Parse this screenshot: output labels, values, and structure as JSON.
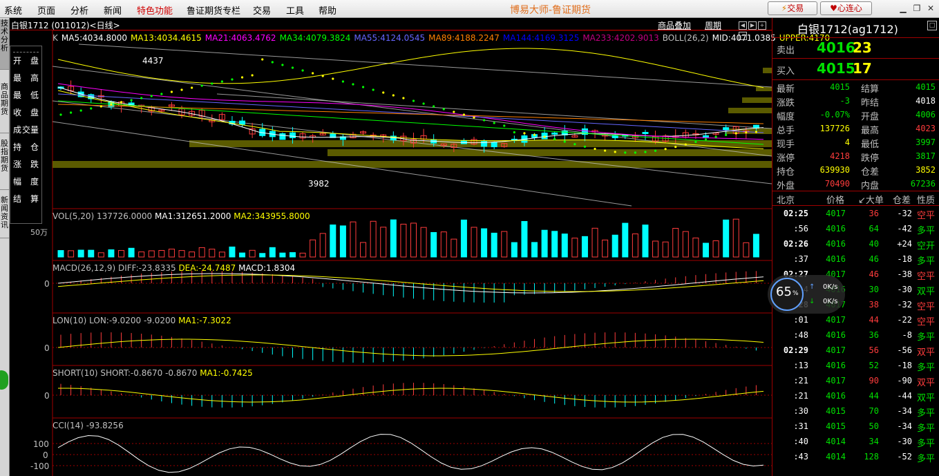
{
  "menu": [
    "系统",
    "页面",
    "分析",
    "新闻",
    "特色功能",
    "鲁证期货专栏",
    "交易",
    "工具",
    "帮助"
  ],
  "app_title": "博易大师-鲁证期货",
  "buttons": {
    "trade": "交易",
    "connect": "心连心"
  },
  "left_tabs": [
    "技术分析",
    "商品期货",
    "股指期货",
    "新闻资讯"
  ],
  "chart": {
    "title": "白银1712 (011012)<日线>",
    "links": [
      "商品叠加",
      "周期"
    ],
    "ma_line": [
      {
        "text": "K",
        "color": "#c0c0c0"
      },
      {
        "text": "MA5:4034.8000",
        "color": "#ffffff"
      },
      {
        "text": "MA13:4034.4615",
        "color": "#ffff00"
      },
      {
        "text": "MA21:4063.4762",
        "color": "#ff00ff"
      },
      {
        "text": "MA34:4079.3824",
        "color": "#00ff00"
      },
      {
        "text": "MA55:4124.0545",
        "color": "#6666ff"
      },
      {
        "text": "MA89:4188.2247",
        "color": "#ff8000"
      },
      {
        "text": "MA144:4169.3125",
        "color": "#0000ff"
      },
      {
        "text": "MA233:4202.9013",
        "color": "#c00080"
      },
      {
        "text": "BOLL(26,2)",
        "color": "#c0c0c0"
      },
      {
        "text": "MID:4071.0385",
        "color": "#ffffff"
      },
      {
        "text": "UPPER:4170",
        "color": "#ffff00"
      }
    ],
    "price_high_label": "4437",
    "price_low_label": "3982",
    "info_box": [
      {
        "l": "开",
        "r": "盘"
      },
      {
        "l": "最",
        "r": "高"
      },
      {
        "l": "最",
        "r": "低"
      },
      {
        "l": "收",
        "r": "盘"
      },
      {
        "l": "成",
        "r": "交量"
      },
      {
        "l": "持",
        "r": "仓"
      },
      {
        "l": "涨",
        "r": "跌"
      },
      {
        "l": "幅",
        "r": "度"
      },
      {
        "l": "结",
        "r": "算"
      }
    ],
    "vol": {
      "label": "VOL(5,20) 137726.0000",
      "ma1": "MA1:312651.2000",
      "ma2": "MA2:343955.8000",
      "axis": "50万"
    },
    "macd": {
      "label": "MACD(26,12,9) DIFF:-23.8335",
      "dea": "DEA:-24.7487",
      "macd": "MACD:1.8304",
      "zero": "0"
    },
    "lon": {
      "label": "LON(10) LON:-9.0200 -9.0200",
      "ma1": "MA1:-7.3022",
      "zero": "0"
    },
    "short": {
      "label": "SHORT(10) SHORT:-0.8670 -0.8670",
      "ma1": "MA1:-0.7425",
      "zero": "0"
    },
    "cci": {
      "label": "CCI(14) -93.8256",
      "ticks": [
        "100",
        "0",
        "-100"
      ]
    }
  },
  "quote": {
    "name": "白银1712(ag1712)",
    "sell": {
      "label": "卖出",
      "price": "4016",
      "vol": "23"
    },
    "buy": {
      "label": "买入",
      "price": "4015",
      "vol": "17"
    },
    "fields": [
      [
        {
          "l": "最新",
          "v": "4015",
          "c": "green"
        },
        {
          "l": "结算",
          "v": "4015",
          "c": "green"
        }
      ],
      [
        {
          "l": "涨跌",
          "v": "-3",
          "c": "green"
        },
        {
          "l": "昨结",
          "v": "4018",
          "c": "white"
        }
      ],
      [
        {
          "l": "幅度",
          "v": "-0.07%",
          "c": "green"
        },
        {
          "l": "开盘",
          "v": "4006",
          "c": "green"
        }
      ],
      [
        {
          "l": "总手",
          "v": "137726",
          "c": "yellow"
        },
        {
          "l": "最高",
          "v": "4023",
          "c": "red"
        }
      ],
      [
        {
          "l": "现手",
          "v": "4",
          "c": "yellow"
        },
        {
          "l": "最低",
          "v": "3997",
          "c": "green"
        }
      ],
      [
        {
          "l": "涨停",
          "v": "4218",
          "c": "red"
        },
        {
          "l": "跌停",
          "v": "3817",
          "c": "green"
        }
      ],
      [
        {
          "l": "持仓",
          "v": "639930",
          "c": "yellow"
        },
        {
          "l": "仓差",
          "v": "3852",
          "c": "yellow"
        }
      ],
      [
        {
          "l": "外盘",
          "v": "70490",
          "c": "red"
        },
        {
          "l": "内盘",
          "v": "67236",
          "c": "green"
        }
      ]
    ],
    "tick_header": [
      "北京",
      "价格",
      "↙大单",
      "仓差",
      "性质"
    ],
    "ticks": [
      {
        "t": "02:25",
        "p": "4017",
        "pc": "green",
        "v": "36",
        "vc": "red",
        "d": "-32",
        "n": "空平",
        "nc": "red",
        "bold": true
      },
      {
        "t": ":56",
        "p": "4016",
        "pc": "green",
        "v": "64",
        "vc": "green",
        "d": "-42",
        "n": "多平",
        "nc": "green",
        "bold": false
      },
      {
        "t": "02:26",
        "p": "4016",
        "pc": "green",
        "v": "40",
        "vc": "green",
        "d": "+24",
        "n": "空开",
        "nc": "green",
        "bold": true
      },
      {
        "t": ":37",
        "p": "4016",
        "pc": "green",
        "v": "46",
        "vc": "green",
        "d": "-18",
        "n": "多平",
        "nc": "green",
        "bold": false
      },
      {
        "t": "02:27",
        "p": "4017",
        "pc": "green",
        "v": "46",
        "vc": "red",
        "d": "-38",
        "n": "空平",
        "nc": "red",
        "bold": true
      },
      {
        "t": ":14",
        "p": "4016",
        "pc": "green",
        "v": "30",
        "vc": "green",
        "d": "-30",
        "n": "双平",
        "nc": "green",
        "bold": false
      },
      {
        "t": "02:28",
        "p": "4017",
        "pc": "green",
        "v": "38",
        "vc": "red",
        "d": "-32",
        "n": "空平",
        "nc": "red",
        "bold": true
      },
      {
        "t": ":01",
        "p": "4017",
        "pc": "green",
        "v": "44",
        "vc": "red",
        "d": "-22",
        "n": "空平",
        "nc": "red",
        "bold": false
      },
      {
        "t": ":48",
        "p": "4016",
        "pc": "green",
        "v": "36",
        "vc": "green",
        "d": "-8",
        "n": "多平",
        "nc": "green",
        "bold": false
      },
      {
        "t": "02:29",
        "p": "4017",
        "pc": "green",
        "v": "56",
        "vc": "red",
        "d": "-56",
        "n": "双平",
        "nc": "red",
        "bold": true
      },
      {
        "t": ":13",
        "p": "4016",
        "pc": "green",
        "v": "52",
        "vc": "green",
        "d": "-18",
        "n": "多平",
        "nc": "green",
        "bold": false
      },
      {
        "t": ":21",
        "p": "4017",
        "pc": "green",
        "v": "90",
        "vc": "red",
        "d": "-90",
        "n": "双平",
        "nc": "red",
        "bold": false
      },
      {
        "t": ":21",
        "p": "4016",
        "pc": "green",
        "v": "44",
        "vc": "green",
        "d": "-44",
        "n": "双平",
        "nc": "green",
        "bold": false
      },
      {
        "t": ":30",
        "p": "4015",
        "pc": "green",
        "v": "70",
        "vc": "green",
        "d": "-34",
        "n": "多平",
        "nc": "green",
        "bold": false
      },
      {
        "t": ":31",
        "p": "4015",
        "pc": "green",
        "v": "50",
        "vc": "green",
        "d": "-34",
        "n": "多平",
        "nc": "green",
        "bold": false
      },
      {
        "t": ":40",
        "p": "4014",
        "pc": "green",
        "v": "34",
        "vc": "green",
        "d": "-30",
        "n": "多平",
        "nc": "green",
        "bold": false
      },
      {
        "t": ":43",
        "p": "4014",
        "pc": "green",
        "v": "128",
        "vc": "green",
        "d": "-52",
        "n": "多平",
        "nc": "green",
        "bold": false
      }
    ]
  },
  "load_badge": {
    "percent": "65",
    "unit": "%",
    "up": "0K/s",
    "down": "0K/s"
  },
  "colors": {
    "up": "#ff3c3c",
    "down": "#00ffff",
    "border": "#a00000"
  }
}
